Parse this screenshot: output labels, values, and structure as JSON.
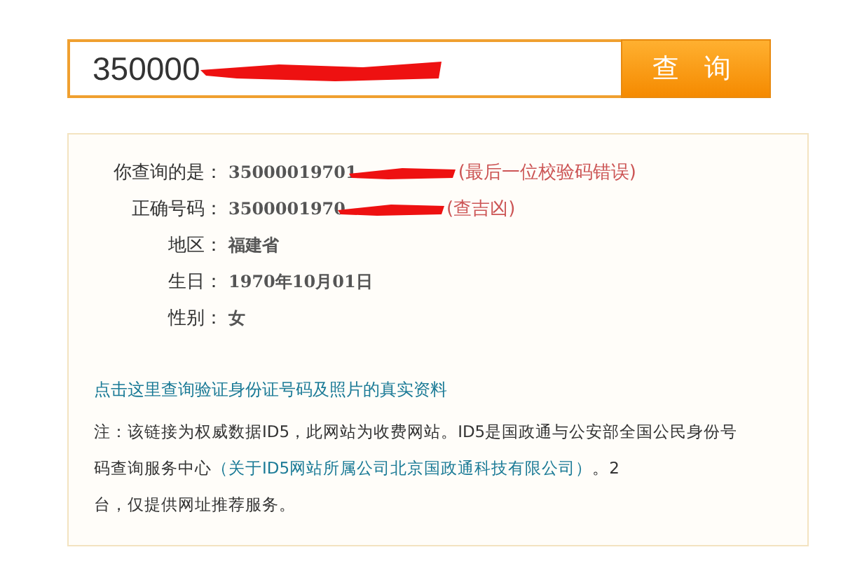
{
  "search": {
    "value": "350000",
    "button": "查 询"
  },
  "result": {
    "rows": [
      {
        "label": "你查询的是：",
        "value": "35000019701",
        "note": "(最后一位校验码错误)",
        "redacted": true
      },
      {
        "label": "正确号码：",
        "value": "3500001970",
        "note": "(查吉凶)",
        "redacted": true
      },
      {
        "label": "地区：",
        "value": "福建省",
        "redacted": false
      },
      {
        "label": "生日：",
        "value": "1970年10月01日",
        "redacted": false
      },
      {
        "label": "性别：",
        "value": "女",
        "redacted": false
      }
    ],
    "link": "点击这里查询验证身份证号码及照片的真实资料",
    "note_prefix": "注：该链接为权威数据ID5，此网站为收费网站。ID5是国政通与公安部全国公民身份号码查询服务中心",
    "note_link": "（关于ID5网站所属公司北京国政通科技有限公司）",
    "note_suffix": "。2",
    "note_last": "台，仅提供网址推荐服务。"
  }
}
